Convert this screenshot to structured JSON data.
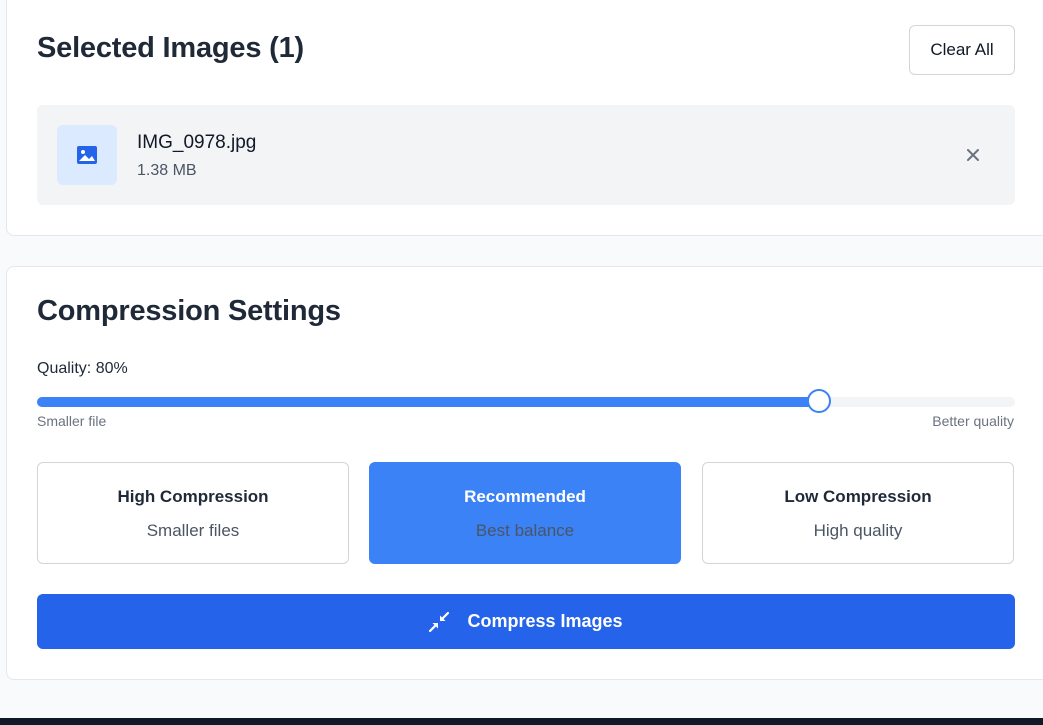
{
  "selected_images": {
    "title": "Selected Images (1)",
    "clear_all_label": "Clear All",
    "files": [
      {
        "name": "IMG_0978.jpg",
        "size": "1.38 MB",
        "icon": "image-icon"
      }
    ],
    "remove_icon": "close-icon"
  },
  "compression": {
    "title": "Compression Settings",
    "quality_label": "Quality: 80%",
    "quality_value": 0.8,
    "slider_min_label": "Smaller file",
    "slider_max_label": "Better quality",
    "presets": [
      {
        "title": "High Compression",
        "subtitle": "Smaller files",
        "active": false
      },
      {
        "title": "Recommended",
        "subtitle": "Best balance",
        "active": true
      },
      {
        "title": "Low Compression",
        "subtitle": "High quality",
        "active": false
      }
    ],
    "compress_button_label": "Compress Images",
    "compress_button_icon": "compress-arrows-icon"
  },
  "colors": {
    "accent": "#3b82f6",
    "primary_button": "#2563eb",
    "thumb_bg": "#dbeafe"
  }
}
